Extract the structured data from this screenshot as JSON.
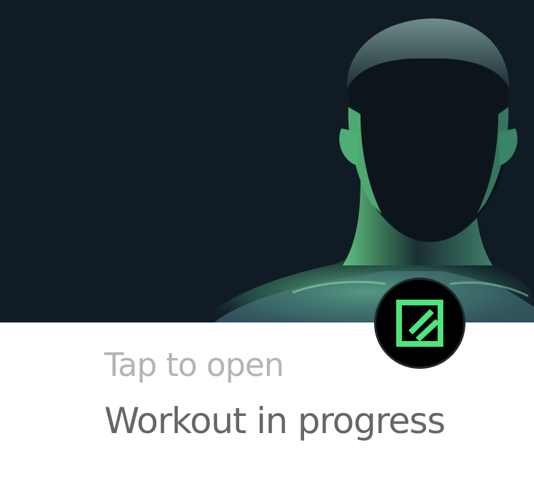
{
  "notification": {
    "subtitle": "Tap to open",
    "title": "Workout in progress"
  },
  "hero": {
    "image": "man-silhouette-green-rim-light",
    "background_color": "#101b25",
    "accent_color": "#4ee57a"
  },
  "app_badge": {
    "icon": "edit-icon",
    "icon_color": "#4ee57a",
    "background_color": "#000000"
  }
}
